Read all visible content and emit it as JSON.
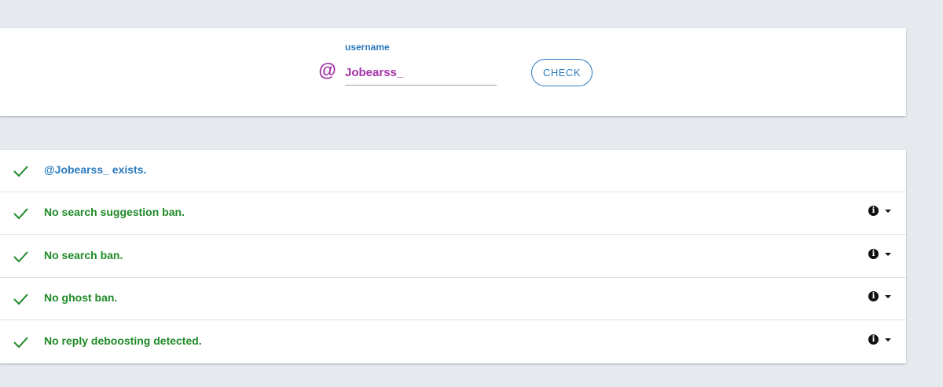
{
  "search": {
    "label": "username",
    "at_symbol": "@",
    "value": "Jobearss_",
    "button_label": "CHECK"
  },
  "results": [
    {
      "text": "@Jobearss_ exists.",
      "has_info": false
    },
    {
      "text": "No search suggestion ban.",
      "has_info": true
    },
    {
      "text": "No search ban.",
      "has_info": true
    },
    {
      "text": "No ghost ban.",
      "has_info": true
    },
    {
      "text": "No reply deboosting detected.",
      "has_info": true
    }
  ],
  "colors": {
    "background": "#e6eaee",
    "accent_blue": "#2a7bbf",
    "username_purple": "#a232a6",
    "success_green": "#1f8a28"
  },
  "icons": {
    "status": "check-icon",
    "info": "info-icon",
    "expand": "caret-down-icon",
    "prefix": "at-icon"
  }
}
